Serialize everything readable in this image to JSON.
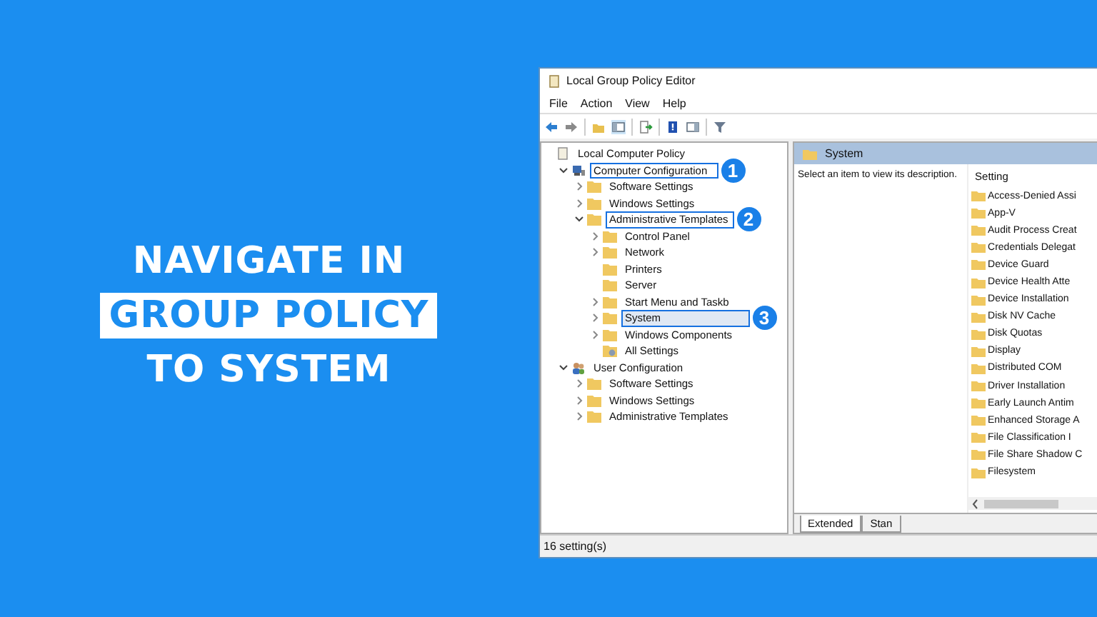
{
  "heading": {
    "lines": [
      {
        "text": "NAVIGATE IN",
        "highlighted": false
      },
      {
        "text": "GROUP POLICY",
        "highlighted": true
      },
      {
        "text": "TO SYSTEM",
        "highlighted": false
      }
    ]
  },
  "window": {
    "title": "Local Group Policy Editor"
  },
  "menu": [
    "File",
    "Action",
    "View",
    "Help"
  ],
  "tree": [
    {
      "label": "Local Computer Policy",
      "kind": "policy",
      "highlighted": false,
      "selected": false,
      "children": [
        {
          "label": "Computer Configuration",
          "kind": "computer",
          "expanded": true,
          "highlighted": true,
          "callout": "1",
          "selected": false,
          "children": [
            {
              "label": "Software Settings",
              "kind": "folder",
              "expanded": false,
              "highlighted": false,
              "selected": false
            },
            {
              "label": "Windows Settings",
              "kind": "folder",
              "expanded": false,
              "highlighted": false,
              "selected": false
            },
            {
              "label": "Administrative Templates",
              "kind": "folder",
              "expanded": true,
              "highlighted": true,
              "callout": "2",
              "selected": false,
              "children": [
                {
                  "label": "Control Panel",
                  "kind": "folder",
                  "expanded": false,
                  "highlighted": false,
                  "selected": false
                },
                {
                  "label": "Network",
                  "kind": "folder",
                  "expanded": false,
                  "highlighted": false,
                  "selected": false
                },
                {
                  "label": "Printers",
                  "kind": "folder",
                  "highlighted": false,
                  "selected": false
                },
                {
                  "label": "Server",
                  "kind": "folder",
                  "highlighted": false,
                  "selected": false
                },
                {
                  "label": "Start Menu and Taskb",
                  "kind": "folder",
                  "expanded": false,
                  "highlighted": false,
                  "selected": false
                },
                {
                  "label": "System",
                  "kind": "folder",
                  "expanded": false,
                  "highlighted": true,
                  "callout": "3",
                  "selected": true
                },
                {
                  "label": "Windows Components",
                  "kind": "folder",
                  "expanded": false,
                  "highlighted": false,
                  "selected": false
                },
                {
                  "label": "All Settings",
                  "kind": "settings",
                  "highlighted": false,
                  "selected": false
                }
              ]
            }
          ]
        },
        {
          "label": "User Configuration",
          "kind": "user",
          "expanded": true,
          "highlighted": false,
          "selected": false,
          "children": [
            {
              "label": "Software Settings",
              "kind": "folder",
              "expanded": false,
              "highlighted": false,
              "selected": false
            },
            {
              "label": "Windows Settings",
              "kind": "folder",
              "expanded": false,
              "highlighted": false,
              "selected": false
            },
            {
              "label": "Administrative Templates",
              "kind": "folder",
              "expanded": false,
              "highlighted": false,
              "selected": false
            }
          ]
        }
      ]
    }
  ],
  "details": {
    "title": "System",
    "description": "Select an item to view its description.",
    "column": "Setting",
    "settings": [
      "Access-Denied Assi",
      "App-V",
      "Audit Process Creat",
      "Credentials Delegat",
      "Device Guard",
      "Device Health Atte",
      "Device Installation",
      "Disk NV Cache",
      "Disk Quotas",
      "Display",
      "Distributed COM",
      "Driver Installation",
      "Early Launch Antim",
      "Enhanced Storage A",
      "File Classification I",
      "File Share Shadow C",
      "Filesystem"
    ],
    "tabs": [
      {
        "label": "Extended",
        "selected": true
      },
      {
        "label": "Stan",
        "selected": false
      }
    ]
  },
  "status_bar": "16 setting(s)"
}
